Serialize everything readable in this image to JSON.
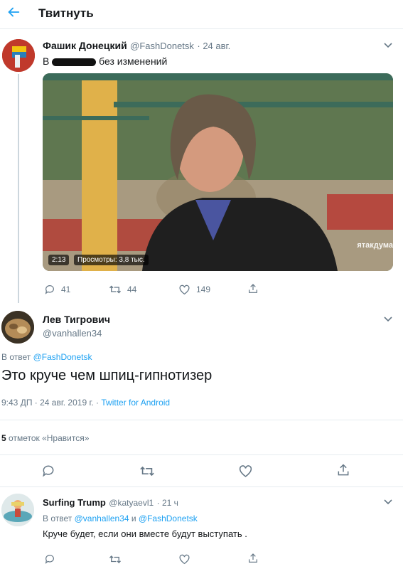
{
  "header": {
    "title": "Твитнуть"
  },
  "tweet1": {
    "author_name": "Фашик Донецкий",
    "author_handle": "@FashDonetsk",
    "date": "· 24 авг.",
    "text_prefix": "В",
    "text_suffix": "без изменений",
    "video": {
      "duration": "2:13",
      "views": "Просмотры: 3,8 тыс.",
      "watermark": "ятакдума"
    },
    "stats": {
      "replies": "41",
      "retweets": "44",
      "likes": "149"
    }
  },
  "tweet2": {
    "author_name": "Лев Тигрович",
    "author_handle": "@vanhallen34",
    "reply_to_label": "В ответ",
    "reply_to_handle": "@FashDonetsk",
    "text": "Это круче чем шпиц-гипнотизер",
    "timestamp": "9:43 ДП · 24 авг. 2019 г. ·",
    "client": "Twitter for Android",
    "likes_count": "5",
    "likes_label": "отметок «Нравится»"
  },
  "tweet3": {
    "author_name": "Surfing Trump",
    "author_handle": "@katyaevl1",
    "time": "· 21 ч",
    "reply_to_label": "В ответ",
    "reply_to_handle1": "@vanhallen34",
    "reply_and": "и",
    "reply_to_handle2": "@FashDonetsk",
    "text": "Круче будет, если они вместе будут выступать ."
  }
}
